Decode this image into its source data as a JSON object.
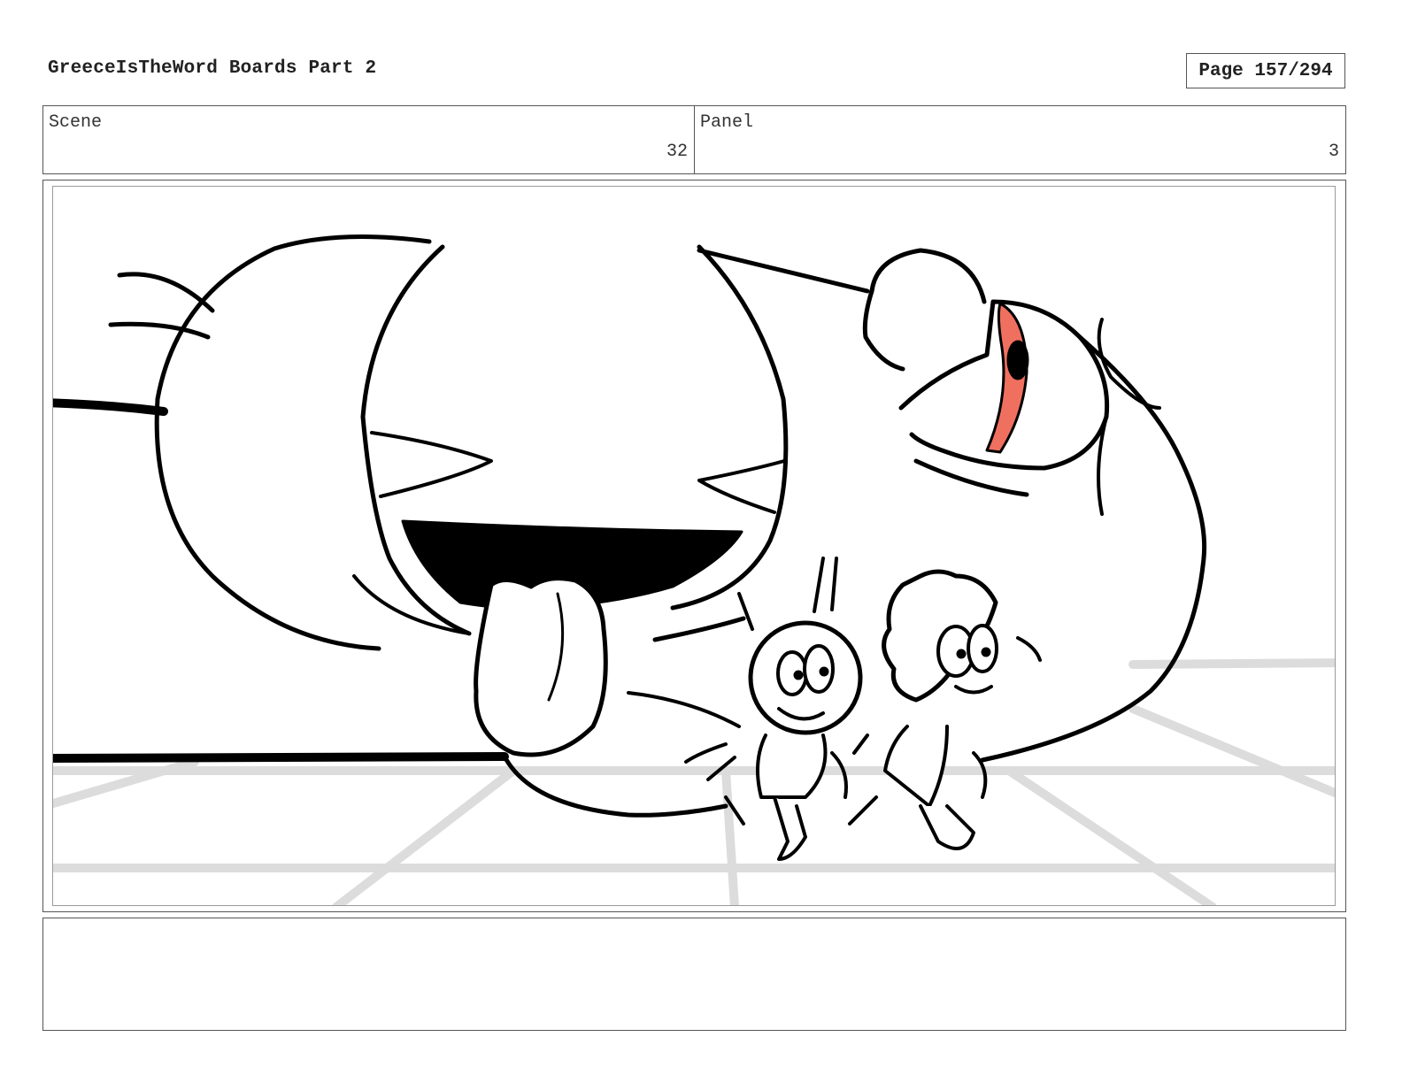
{
  "document": {
    "title": "GreeceIsTheWord Boards Part 2",
    "page_label": "Page 157/294"
  },
  "info": {
    "scene_label": "Scene",
    "scene_value": "32",
    "panel_label": "Panel",
    "panel_value": "3"
  },
  "notes": {
    "text": ""
  },
  "colors": {
    "ink": "#000000",
    "eye_accent": "#f07060",
    "floor_grid": "#d9d9d9"
  }
}
